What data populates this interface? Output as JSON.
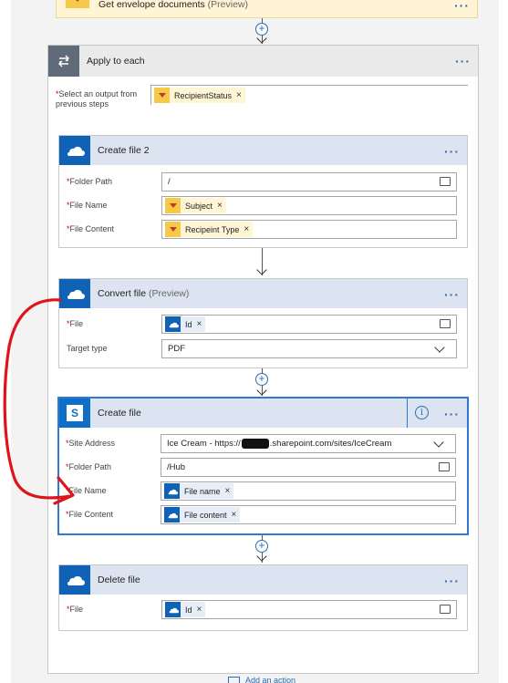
{
  "top_card": {
    "title": "Get envelope documents",
    "subtitle": "(Preview)",
    "more": "···"
  },
  "apply_each": {
    "title": "Apply to each",
    "more": "···",
    "select_label": "Select an output from previous steps",
    "token": "RecipientStatus"
  },
  "create_file_2": {
    "title": "Create file 2",
    "more": "···",
    "folder_label": "Folder Path",
    "folder_value": "/",
    "filename_label": "File Name",
    "filename_token": "Subject",
    "content_label": "File Content",
    "content_token": "Recipeint Type"
  },
  "convert_file": {
    "title": "Convert file",
    "subtitle": "(Preview)",
    "more": "···",
    "file_label": "File",
    "file_token": "Id",
    "target_label": "Target type",
    "target_value": "PDF"
  },
  "create_file": {
    "title": "Create file",
    "more": "···",
    "site_label": "Site Address",
    "site_value_prefix": "Ice Cream - https://",
    "site_value_suffix": ".sharepoint.com/sites/IceCream",
    "folder_label": "Folder Path",
    "folder_value": "/Hub",
    "filename_label": "File Name",
    "filename_token": "File name",
    "content_label": "File Content",
    "content_token": "File content"
  },
  "delete_file": {
    "title": "Delete file",
    "more": "···",
    "file_label": "File",
    "file_token": "Id"
  },
  "add_action": "Add an action",
  "required_mark": "*",
  "remove_mark": "×",
  "colors": {
    "accent": "#2b6cb0",
    "onedrive": "#0f62b5",
    "sharepoint": "#0f6ec7",
    "annotation": "#e0131a",
    "token_yellow": "#f7c948"
  }
}
